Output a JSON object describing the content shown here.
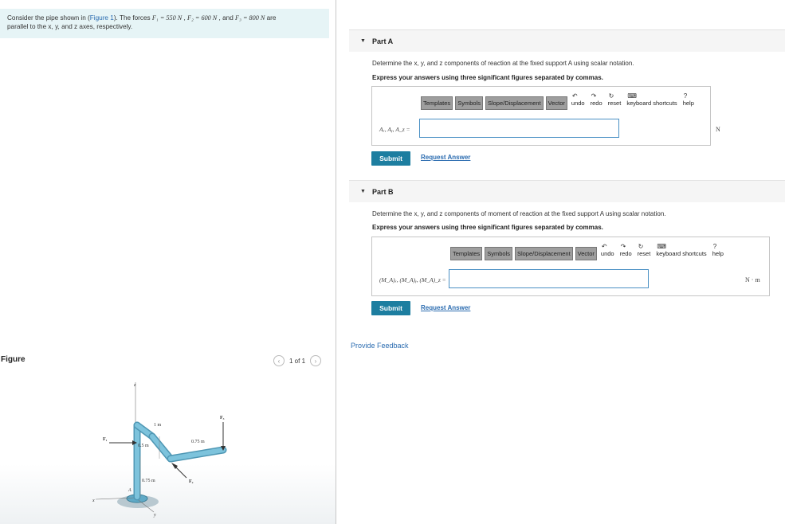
{
  "problem": {
    "pre": "Consider the pipe shown in (",
    "link": "Figure 1",
    "post1": "). The forces ",
    "f1": "F₁ = 550 N",
    "sep1": " , ",
    "f2": "F₂ = 600 N",
    "sep2": " , and ",
    "f3": "F₃ = 800 N",
    "post2": " are",
    "line2": "parallel to the x, y, and z axes, respectively."
  },
  "figure": {
    "label": "Figure",
    "pager_text": "1 of 1",
    "prev_icon": "chevron-left-icon",
    "next_icon": "chevron-right-icon",
    "labels": {
      "z": "z",
      "x": "x",
      "y": "y",
      "A": "A",
      "f1": "F₁",
      "f2": "F₂",
      "f3": "F₃",
      "d1": "1 m",
      "d2": "0.5 m",
      "d3": "0.75 m",
      "d4": "0.75 m"
    }
  },
  "part_a": {
    "title": "Part A",
    "question": "Determine the x, y, and z components of reaction at the fixed support A using scalar notation.",
    "instruction": "Express your answers using three significant figures separated by commas.",
    "lhs": "Aₓ, Aᵧ, A_z =",
    "unit": "N",
    "submit": "Submit",
    "request": "Request Answer"
  },
  "part_b": {
    "title": "Part B",
    "question": "Determine the x, y, and z components of moment of reaction at the fixed support A using scalar notation.",
    "instruction": "Express your answers using three significant figures separated by commas.",
    "lhs": "(M_A)ₓ, (M_A)ᵧ, (M_A)_z =",
    "unit": "N · m",
    "submit": "Submit",
    "request": "Request Answer"
  },
  "toolbar": {
    "templates": "Templates",
    "symbols": "Symbols",
    "slope": "Slope/Displacement",
    "vector": "Vector",
    "undo": "undo",
    "redo": "redo",
    "reset": "reset",
    "shortcuts": "keyboard shortcuts",
    "help": "help"
  },
  "feedback": "Provide Feedback",
  "colors": {
    "accent": "#1d7ea0",
    "link": "#2b6cb0",
    "problem_bg": "#e6f4f6",
    "pipe": "#7dc3dc"
  }
}
